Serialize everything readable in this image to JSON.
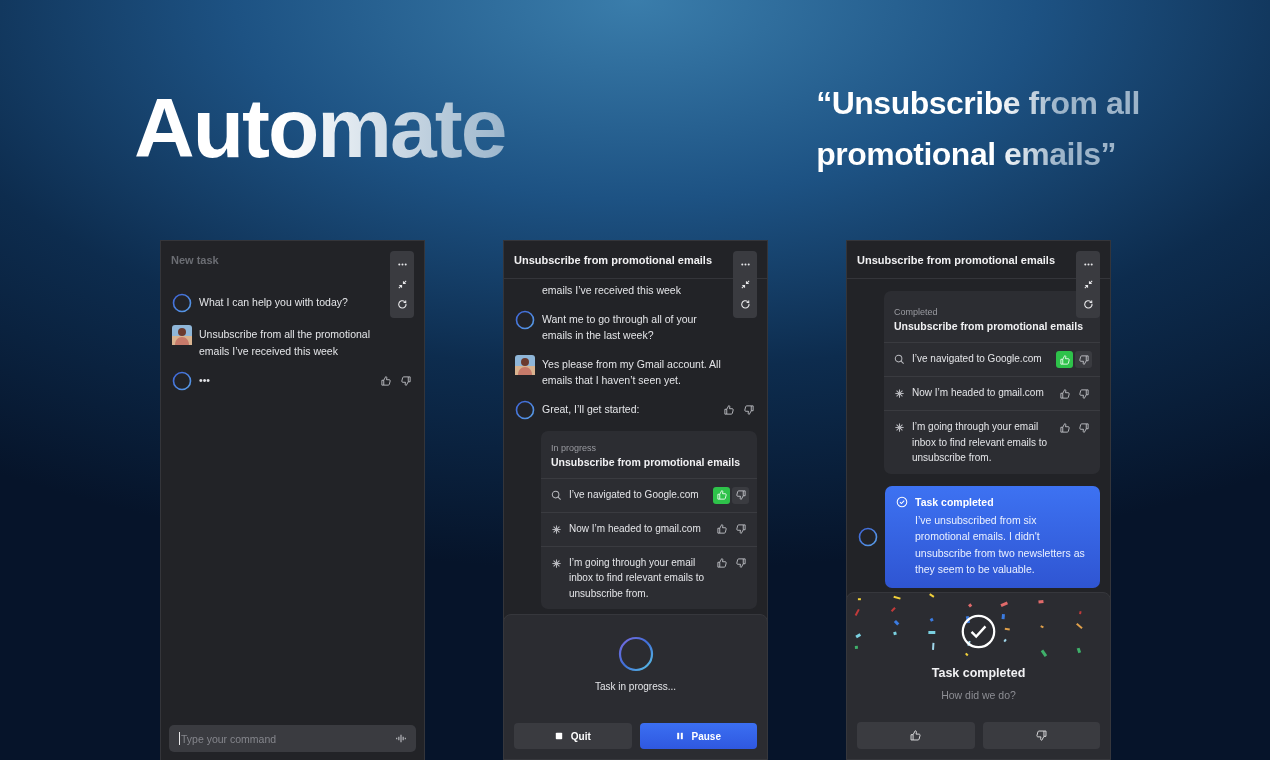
{
  "hero": {
    "title": "Automate",
    "quote_lines": [
      "“Unsubscribe from all",
      "promotional emails”"
    ]
  },
  "panels": [
    {
      "kind": "new",
      "title": "New task",
      "messages": [
        {
          "kind": "assistant",
          "text": "What I can help you with today?",
          "feedback": false
        },
        {
          "kind": "user",
          "text": "Unsubscribe from all the promotional emails I’ve received this week"
        },
        {
          "kind": "assistant",
          "text": "•••",
          "feedback": true
        }
      ],
      "footer": {
        "kind": "input",
        "placeholder": "Type your command"
      }
    },
    {
      "kind": "progress",
      "title": "Unsubscribe from promotional emails",
      "messages": [
        {
          "kind": "partial",
          "text": "emails I’ve received this week"
        },
        {
          "kind": "assistant",
          "text": "Want me to go through all of your emails in the last week?",
          "feedback": false
        },
        {
          "kind": "user",
          "text": "Yes please from my Gmail account. All emails that I haven’t seen yet."
        },
        {
          "kind": "assistant",
          "text": "Great, I’ll get started:",
          "feedback": true
        },
        {
          "kind": "task",
          "status": "In progress",
          "title": "Unsubscribe from promotional emails",
          "steps": [
            {
              "kind": "search",
              "text": "I’ve navigated to Google.com",
              "liked": true
            },
            {
              "kind": "sparkle",
              "text": "Now I’m headed to gmail.com",
              "liked": false
            },
            {
              "kind": "sparkle",
              "text": "I’m going through your email inbox to find relevant emails to unsubscribe from.",
              "liked": false
            }
          ]
        }
      ],
      "footer": {
        "kind": "progress",
        "status": "Task in progress...",
        "buttons": [
          {
            "label": "Quit",
            "kind": "stop"
          },
          {
            "label": "Pause",
            "kind": "pause"
          }
        ]
      }
    },
    {
      "kind": "done",
      "title": "Unsubscribe from promotional emails",
      "messages": [
        {
          "kind": "task",
          "status": "Completed",
          "title": "Unsubscribe from promotional emails",
          "steps": [
            {
              "kind": "search",
              "text": "I’ve navigated to Google.com",
              "liked": true
            },
            {
              "kind": "sparkle",
              "text": "Now I’m headed to gmail.com",
              "liked": false
            },
            {
              "kind": "sparkle",
              "text": "I’m going through your email inbox to find relevant emails to unsubscribe from.",
              "liked": false
            }
          ]
        },
        {
          "kind": "result",
          "title": "Task completed",
          "text": "I’ve unsubscribed from six promotional emails. I didn't unsubscribe from two newsletters as they seem to be valuable."
        }
      ],
      "footer": {
        "kind": "rating",
        "title": "Task completed",
        "question": "How did we do?"
      }
    }
  ]
}
